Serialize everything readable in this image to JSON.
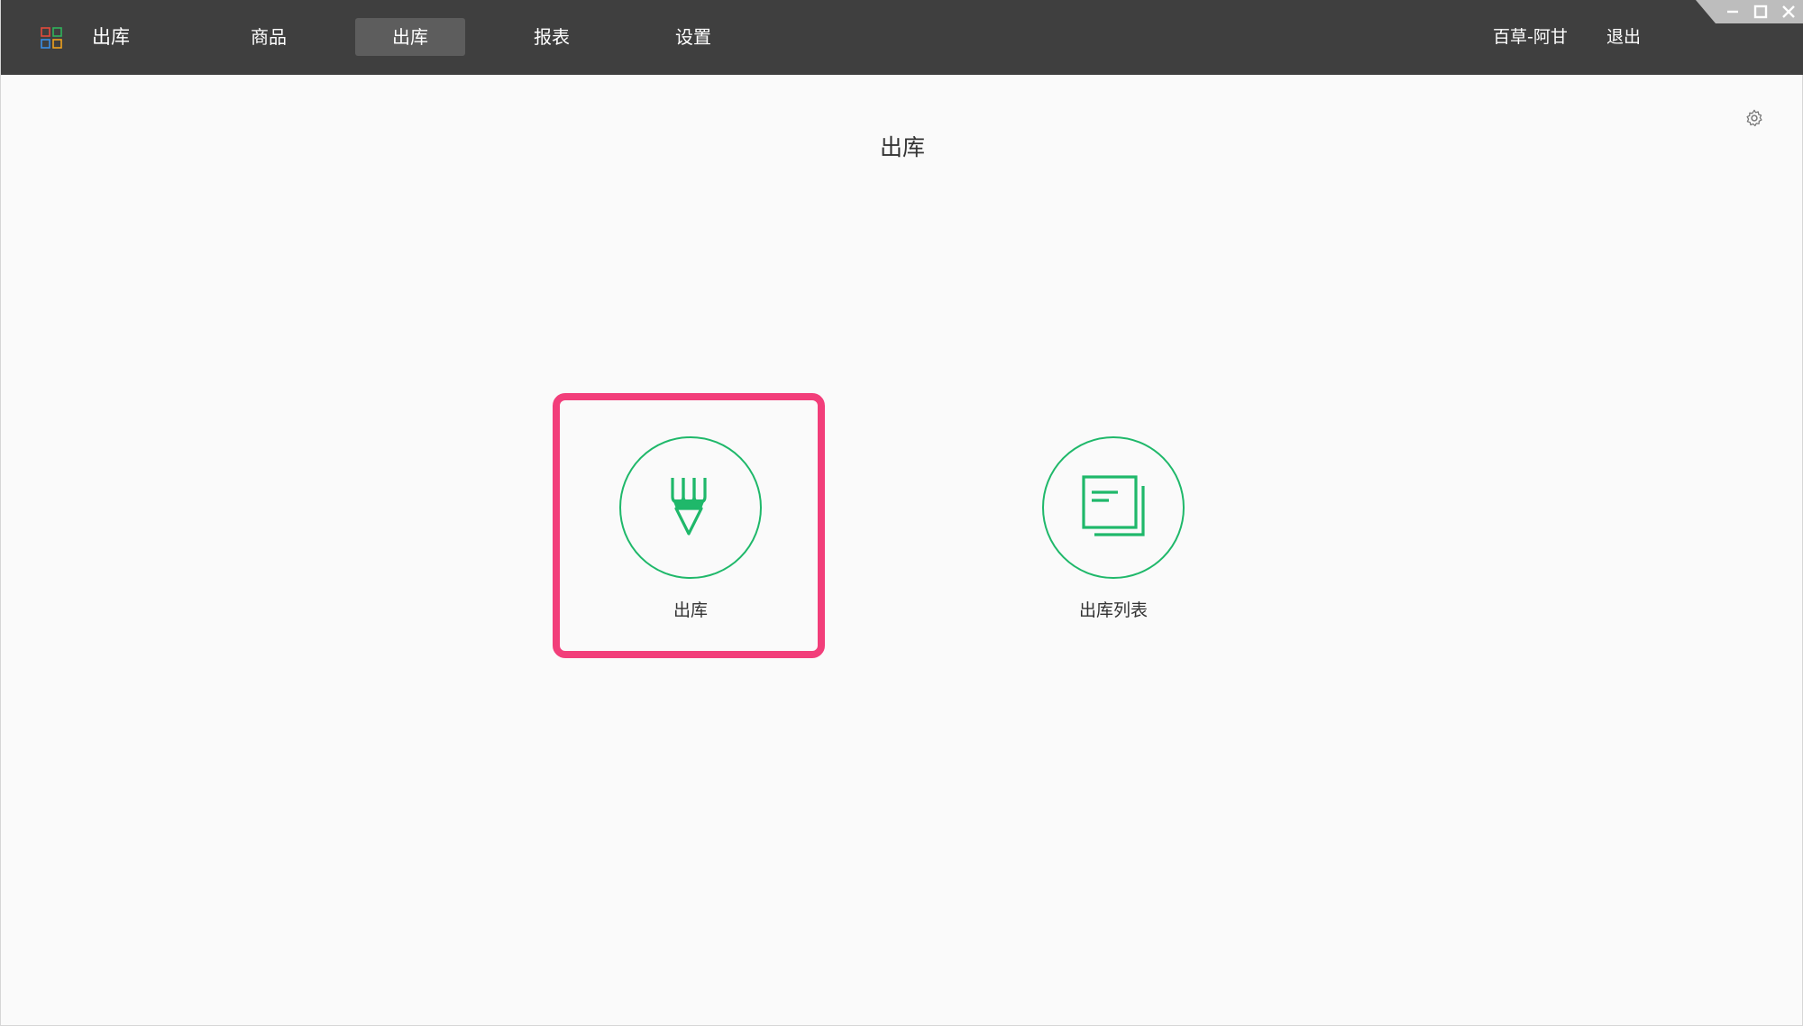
{
  "app": {
    "title": "出库"
  },
  "nav": {
    "items": [
      {
        "label": "商品"
      },
      {
        "label": "出库"
      },
      {
        "label": "报表"
      },
      {
        "label": "设置"
      }
    ],
    "active_index": 1
  },
  "header": {
    "user": "百草-阿甘",
    "logout_label": "退出"
  },
  "page": {
    "title": "出库"
  },
  "tiles": [
    {
      "label": "出库",
      "icon": "pencil-icon"
    },
    {
      "label": "出库列表",
      "icon": "document-list-icon"
    }
  ],
  "colors": {
    "topbar": "#3f3f3f",
    "nav_active": "#5d5d5d",
    "accent_green": "#1fb86a",
    "highlight_pink": "#f23e7a",
    "background": "#fafafa"
  }
}
